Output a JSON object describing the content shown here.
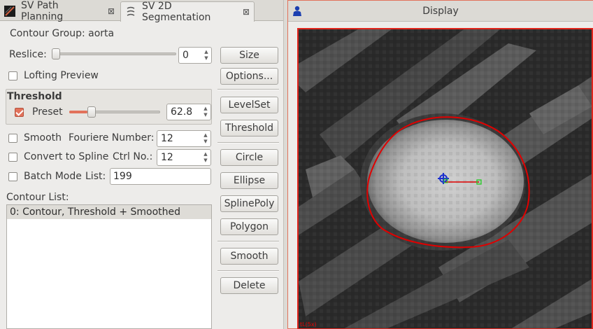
{
  "tabs": [
    {
      "label": "SV Path Planning"
    },
    {
      "label": "SV 2D Segmentation"
    }
  ],
  "segmentation": {
    "contour_group": "Contour Group: aorta",
    "reslice_label": "Reslice:",
    "reslice_value": "0",
    "reslice_level": 0.0,
    "lofting_label": "Lofting Preview",
    "lofting_checked": false,
    "threshold_title": "Threshold",
    "preset_label": "Preset",
    "preset_checked": true,
    "preset_value": "62.8",
    "preset_level": 0.2,
    "smooth_label": "Smooth",
    "smooth_checked": false,
    "fourier_label": "Fouriere Number:",
    "fourier_value": "12",
    "spline_label": "Convert to Spline",
    "spline_checked": false,
    "ctrl_label": "Ctrl No.:",
    "ctrl_value": "12",
    "batch_label": "Batch Mode",
    "batch_checked": false,
    "list_label": "List:",
    "list_value": "199",
    "contour_list_label": "Contour List:",
    "contour_list": [
      "0: Contour, Threshold + Smoothed"
    ]
  },
  "buttons": {
    "size": "Size",
    "options": "Options...",
    "levelset": "LevelSet",
    "threshold": "Threshold",
    "circle": "Circle",
    "ellipse": "Ellipse",
    "splinepoly": "SplinePoly",
    "polygon": "Polygon",
    "smooth": "Smooth",
    "delete": "Delete"
  },
  "display": {
    "title": "Display",
    "accent_color": "#e1241c",
    "contour_color": "#e00000",
    "orientation_label": "tL(5x)"
  },
  "colors": {
    "checkbox_accent": "#e2725b"
  },
  "icons": {
    "path_planning": "path-planning-icon",
    "segmentation": "segmentation-icon",
    "tab_close": "close-icon",
    "display": "display-icon"
  }
}
